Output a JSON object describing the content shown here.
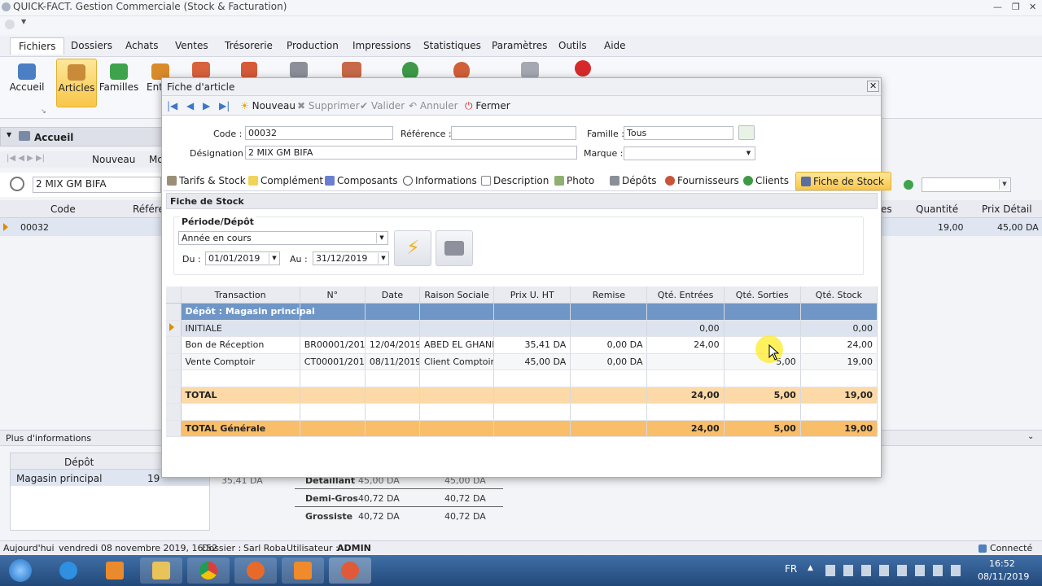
{
  "app": {
    "title": "QUICK-FACT. Gestion Commerciale (Stock & Facturation)"
  },
  "menu": [
    "Fichiers",
    "Dossiers",
    "Achats",
    "Ventes",
    "Trésorerie",
    "Production",
    "Impressions",
    "Statistiques",
    "Paramètres",
    "Outils",
    "Aide"
  ],
  "ribbon": {
    "accueil": "Accueil",
    "articles": "Articles",
    "familles": "Familles",
    "ent": "Ent"
  },
  "background": {
    "nav_title": "Accueil",
    "tool_nouveau": "Nouveau",
    "tool_mo": "Mo",
    "search_value": "2 MIX GM BIFA",
    "col_code": "Code",
    "col_ref": "Référen",
    "row_code": "00032",
    "col_es": "es",
    "col_quantite": "Quantité",
    "col_prix_detail": "Prix Détail",
    "row_quantite": "19,00",
    "row_prix_detail": "45,00 DA",
    "plus_info": "Plus d'informations",
    "depot_col": "Dépôt",
    "depot_row": "Magasin principal",
    "depot_qty": "19",
    "price_base": "35,41 DA",
    "prices": [
      {
        "label": "Détaillant",
        "v1": "45,00 DA",
        "v2": "45,00 DA"
      },
      {
        "label": "Demi-Gros",
        "v1": "40,72 DA",
        "v2": "40,72 DA"
      },
      {
        "label": "Grossiste",
        "v1": "40,72 DA",
        "v2": "40,72 DA"
      }
    ]
  },
  "dialog": {
    "title": "Fiche d'article",
    "toolbar": {
      "nouveau": "Nouveau",
      "supprimer": "Supprimer",
      "valider": "Valider",
      "annuler": "Annuler",
      "fermer": "Fermer"
    },
    "form": {
      "code_label": "Code :",
      "code_value": "00032",
      "reference_label": "Référence :",
      "reference_value": "",
      "famille_label": "Famille :",
      "famille_value": "Tous",
      "designation_label": "Désignation :",
      "designation_value": "2 MIX GM BIFA",
      "marque_label": "Marque :",
      "marque_value": ""
    },
    "tabs": [
      "Tarifs & Stock",
      "Complément",
      "Composants",
      "Informations",
      "Description",
      "Photo",
      "Dépôts",
      "Fournisseurs",
      "Clients",
      "Fiche de Stock"
    ],
    "section_title": "Fiche de Stock",
    "periode": {
      "legend": "Période/Dépôt",
      "select_value": "Année en cours",
      "du_label": "Du :",
      "du_value": "01/01/2019",
      "au_label": "Au :",
      "au_value": "31/12/2019"
    },
    "grid": {
      "columns": [
        "Transaction",
        "N°",
        "Date",
        "Raison Sociale",
        "Prix U. HT",
        "Remise",
        "Qté. Entrées",
        "Qté. Sorties",
        "Qté. Stock"
      ],
      "depot_row": "Dépôt : Magasin principal",
      "rows": [
        {
          "transaction": "INITIALE",
          "num": "",
          "date": "",
          "raison": "",
          "prix": "",
          "remise": "",
          "entrees": "0,00",
          "sorties": "",
          "stock": "0,00"
        },
        {
          "transaction": "Bon de Réception",
          "num": "BR00001/2019",
          "date": "12/04/2019",
          "raison": "ABED EL GHANI",
          "prix": "35,41 DA",
          "remise": "0,00 DA",
          "entrees": "24,00",
          "sorties": "",
          "stock": "24,00"
        },
        {
          "transaction": "Vente Comptoir",
          "num": "CT00001/2019",
          "date": "08/11/2019",
          "raison": "Client Comptoir",
          "prix": "45,00 DA",
          "remise": "0,00 DA",
          "entrees": "",
          "sorties": "5,00",
          "stock": "19,00"
        }
      ],
      "total": {
        "label": "TOTAL",
        "entrees": "24,00",
        "sorties": "5,00",
        "stock": "19,00"
      },
      "total_general": {
        "label": "TOTAL Générale",
        "entrees": "24,00",
        "sorties": "5,00",
        "stock": "19,00"
      }
    }
  },
  "status": {
    "today_label": "Aujourd'hui",
    "today_value": "vendredi 08 novembre 2019, 16:52",
    "dossier_label": "Dossier :",
    "dossier_value": "Sarl Roba",
    "user_label": "Utilisateur :",
    "user_value": "ADMIN",
    "connection": "Connecté"
  },
  "taskbar": {
    "lang": "FR",
    "time": "16:52",
    "date": "08/11/2019"
  }
}
